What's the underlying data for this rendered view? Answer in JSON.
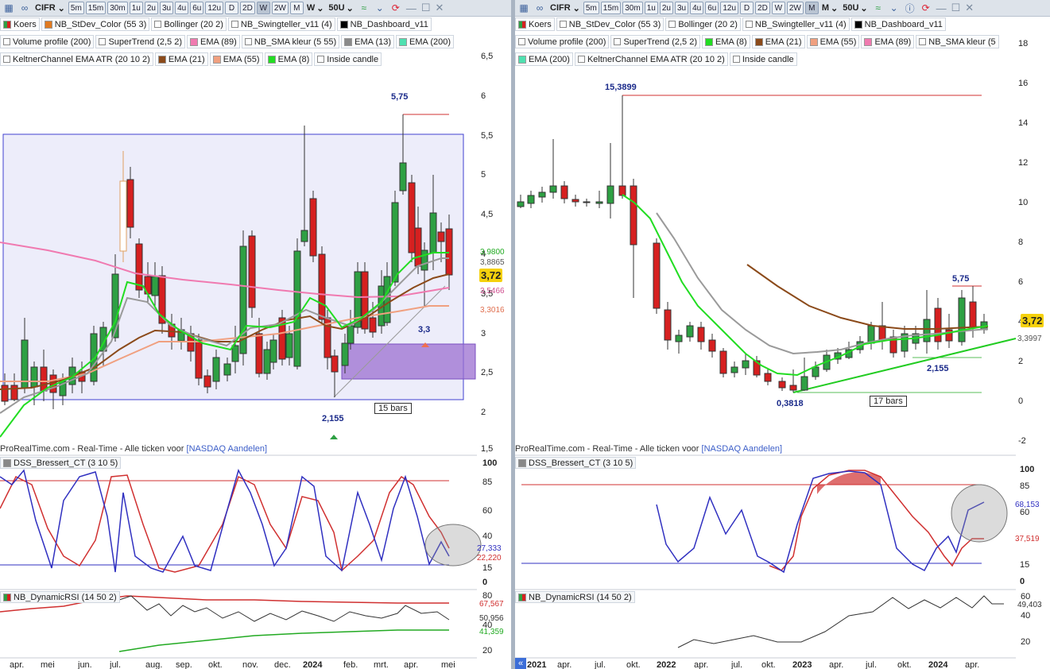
{
  "left": {
    "toolbar": {
      "ticker": "CIFR",
      "timeframes": [
        "5m",
        "15m",
        "30m",
        "1u",
        "2u",
        "3u",
        "4u",
        "6u",
        "12u",
        "D",
        "2D",
        "W",
        "2W",
        "M"
      ],
      "active_timeframe": "W",
      "period": "W",
      "units": "50U"
    },
    "legend_row1": [
      {
        "label": "Koers",
        "color": "#d62020"
      },
      {
        "label": "NB_StDev_Color (55 3)",
        "color": "#e07a20"
      },
      {
        "label": "Bollinger (20 2)",
        "color": ""
      },
      {
        "label": "NB_Swingteller_v11 (4)",
        "color": ""
      },
      {
        "label": "NB_Dashboard_v11",
        "color": "#000000"
      }
    ],
    "legend_row2": [
      {
        "label": "Volume profile (200)",
        "color": ""
      },
      {
        "label": "SuperTrend (2,5 2)",
        "color": ""
      },
      {
        "label": "EMA (89)",
        "color": "#f07ab0"
      },
      {
        "label": "NB_SMA kleur (5 55)",
        "color": ""
      },
      {
        "label": "EMA (13)",
        "color": "#8a8a8a"
      },
      {
        "label": "EMA (200)",
        "color": "#4fe0b0"
      }
    ],
    "legend_row3": [
      {
        "label": "KeltnerChannel EMA ATR (20 10 2)",
        "color": ""
      },
      {
        "label": "EMA (21)",
        "color": "#8b4a1a"
      },
      {
        "label": "EMA (55)",
        "color": "#f0a080"
      },
      {
        "label": "EMA (8)",
        "color": "#22dd22"
      },
      {
        "label": "Inside candle",
        "color": ""
      }
    ],
    "price_axis": [
      "6,5",
      "6",
      "5,5",
      "5",
      "4,5",
      "4",
      "3,5",
      "3",
      "2,5",
      "2",
      "1,5"
    ],
    "price_labels": {
      "current": "3,72",
      "l1": "3,9800",
      "l2": "3,8865",
      "l3": "3,5466",
      "l4": "3,3016"
    },
    "annotations": {
      "high": "5,75",
      "mid": "3,3",
      "low": "2,155",
      "bars": "15 bars"
    },
    "source": "ProRealTime.com - Real-Time - Alle ticken voor",
    "exchange": "[NASDAQ Aandelen]",
    "dss": {
      "label": "DSS_Bressert_CT (3 10 5)",
      "axis": [
        "100",
        "85",
        "60",
        "40",
        "15",
        "0"
      ],
      "val1": "27,333",
      "val2": "22,220"
    },
    "rsi": {
      "label": "NB_DynamicRSI (14 50 2)",
      "axis": [
        "80",
        "40",
        "20"
      ],
      "val1": "67,567",
      "val2": "50,956",
      "val3": "41,359"
    },
    "time_axis": [
      "apr.",
      "mei",
      "jun.",
      "jul.",
      "aug.",
      "sep.",
      "okt.",
      "nov.",
      "dec.",
      "2024",
      "feb.",
      "mrt.",
      "apr.",
      "mei"
    ]
  },
  "right": {
    "toolbar": {
      "ticker": "CIFR",
      "timeframes": [
        "5m",
        "15m",
        "30m",
        "1u",
        "2u",
        "3u",
        "4u",
        "6u",
        "12u",
        "D",
        "2D",
        "W",
        "2W",
        "M"
      ],
      "active_timeframe": "M",
      "period": "M",
      "units": "50U"
    },
    "legend_row1": [
      {
        "label": "Koers",
        "color": "#d62020"
      },
      {
        "label": "NB_StDev_Color (55 3)",
        "color": ""
      },
      {
        "label": "Bollinger (20 2)",
        "color": ""
      },
      {
        "label": "NB_Swingteller_v11 (4)",
        "color": ""
      },
      {
        "label": "NB_Dashboard_v11",
        "color": "#000000"
      }
    ],
    "legend_row2": [
      {
        "label": "Volume profile (200)",
        "color": ""
      },
      {
        "label": "SuperTrend (2,5 2)",
        "color": ""
      },
      {
        "label": "EMA (8)",
        "color": "#22dd22"
      },
      {
        "label": "EMA (21)",
        "color": "#8b4a1a"
      },
      {
        "label": "EMA (55)",
        "color": "#f0a080"
      },
      {
        "label": "EMA (89)",
        "color": "#f07ab0"
      },
      {
        "label": "NB_SMA kleur (5",
        "color": ""
      }
    ],
    "legend_row3": [
      {
        "label": "EMA (200)",
        "color": "#4fe0b0"
      },
      {
        "label": "KeltnerChannel EMA ATR (20 10 2)",
        "color": ""
      },
      {
        "label": "Inside candle",
        "color": ""
      }
    ],
    "price_axis": [
      "18",
      "16",
      "14",
      "12",
      "10",
      "8",
      "6",
      "4",
      "2",
      "0",
      "-2"
    ],
    "price_labels": {
      "current": "3,72",
      "l1": "3,3997"
    },
    "annotations": {
      "high": "15,3899",
      "mid": "5,75",
      "low": "0,3818",
      "low2": "2,155",
      "bars": "17 bars"
    },
    "source": "ProRealTime.com - Real-Time - Alle ticken voor",
    "exchange": "[NASDAQ Aandelen]",
    "dss": {
      "label": "DSS_Bressert_CT (3 10 5)",
      "axis": [
        "100",
        "85",
        "60",
        "15",
        "0"
      ],
      "val1": "68,153",
      "val2": "37,519"
    },
    "rsi": {
      "label": "NB_DynamicRSI (14 50 2)",
      "axis": [
        "60",
        "40",
        "20"
      ],
      "val1": "49,403"
    },
    "time_axis": [
      "2021",
      "apr.",
      "jul.",
      "okt.",
      "2022",
      "apr.",
      "jul.",
      "okt.",
      "2023",
      "apr.",
      "jul.",
      "okt.",
      "2024",
      "apr."
    ]
  }
}
